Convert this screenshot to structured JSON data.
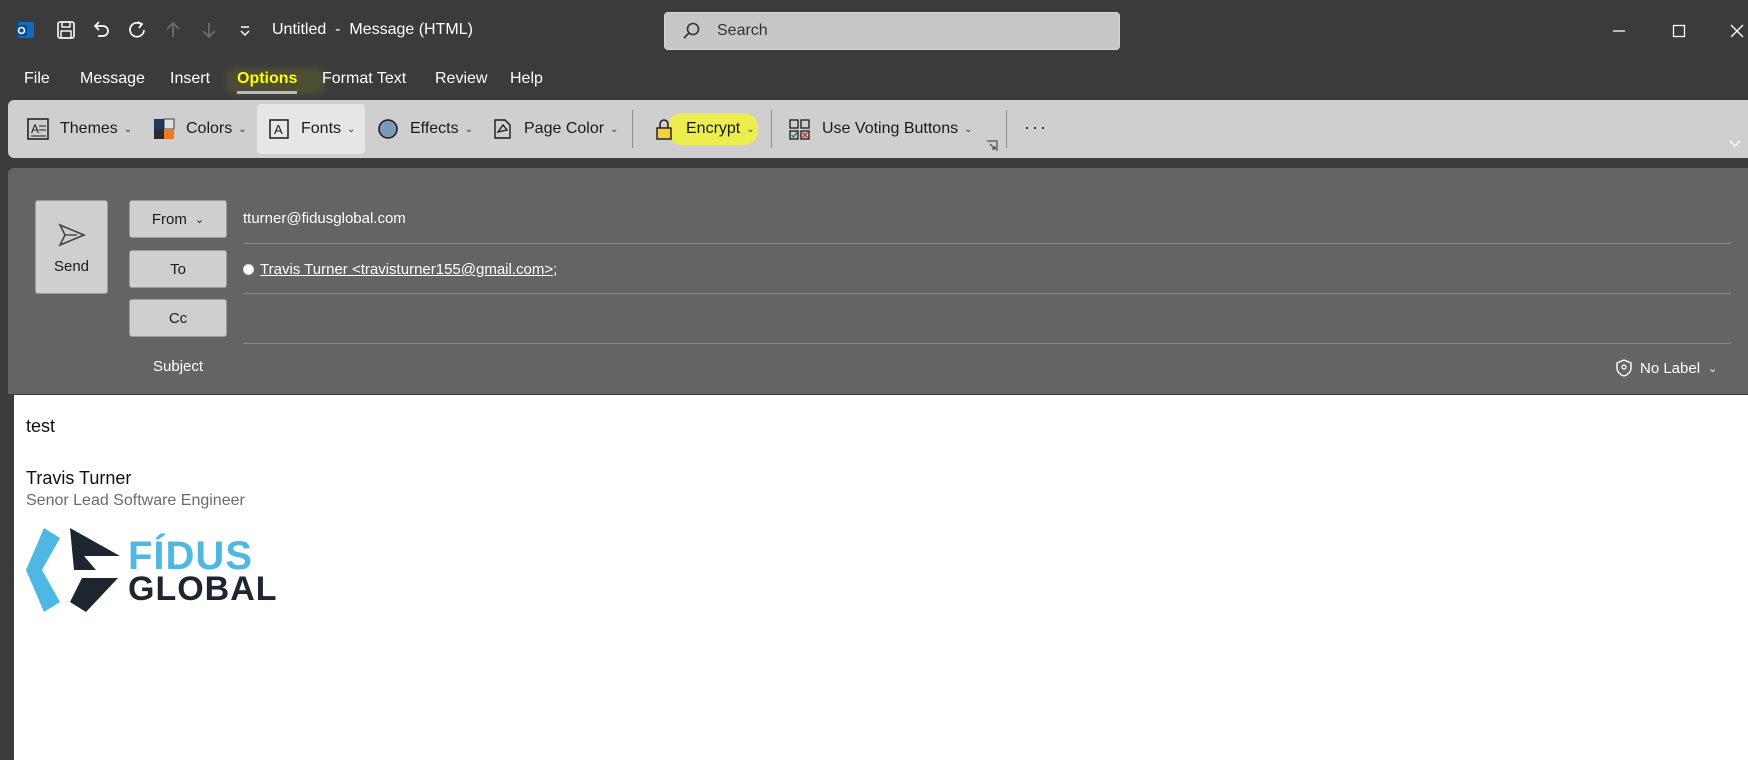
{
  "window": {
    "title": "Untitled  -  Message (HTML)",
    "search_placeholder": "Search"
  },
  "menu": {
    "tabs": [
      {
        "label": "File"
      },
      {
        "label": "Message"
      },
      {
        "label": "Insert"
      },
      {
        "label": "Options",
        "active": true
      },
      {
        "label": "Format Text"
      },
      {
        "label": "Review"
      },
      {
        "label": "Help"
      }
    ]
  },
  "ribbon": {
    "themes": "Themes",
    "colors": "Colors",
    "fonts": "Fonts",
    "effects": "Effects",
    "page_color": "Page Color",
    "encrypt": "Encrypt",
    "voting": "Use Voting Buttons",
    "more": "···"
  },
  "header": {
    "send_label": "Send",
    "from_label": "From",
    "from_value": "tturner@fidusglobal.com",
    "to_label": "To",
    "to_value": "Travis Turner <travisturner155@gmail.com>",
    "to_separator": ";",
    "cc_label": "Cc",
    "subject_label": "Subject",
    "sensitivity_label": "No Label"
  },
  "body": {
    "text": "test",
    "signature_name": "Travis Turner",
    "signature_title": "Senor Lead Software Engineer",
    "logo_word1": "FÍDUS",
    "logo_word2": "GLOBAL"
  },
  "colors": {
    "accent_highlight": "#ffff00",
    "logo_blue": "#4fb7e3",
    "logo_dark": "#1c2530"
  }
}
